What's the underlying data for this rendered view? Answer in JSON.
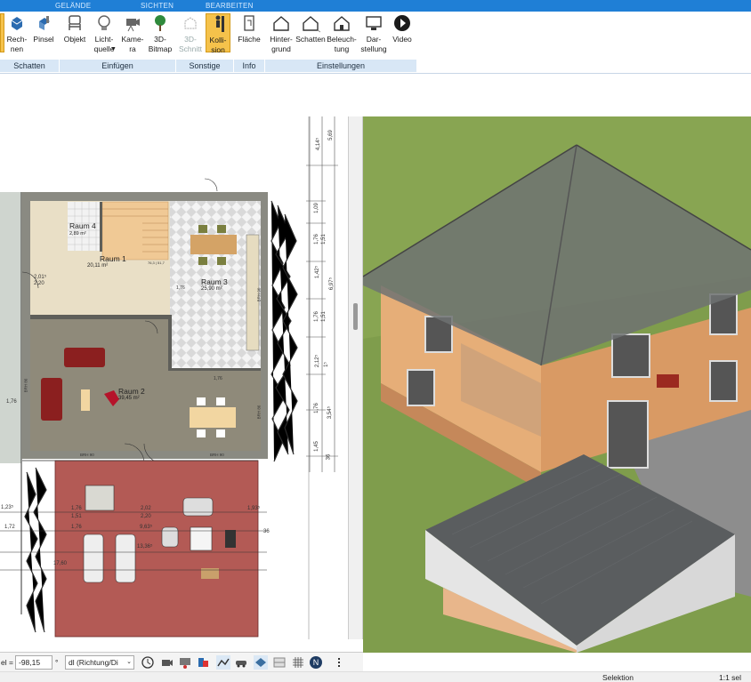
{
  "ribbon": {
    "tabs": [
      "GELÄNDE",
      "SICHTEN",
      "BEARBEITEN"
    ],
    "buttons": {
      "rechnen": "Rech-\nnen",
      "pinsel": "Pinsel",
      "objekt": "Objekt",
      "lichtquelle": "Licht-\nquelle",
      "kamera": "Kame-\nra",
      "bitmap3d": "3D-\nBitmap",
      "schnitt3d": "3D-\nSchnitt",
      "kollision": "Kolli-\nsion",
      "flaeche": "Fläche",
      "hintergrund": "Hinter-\ngrund",
      "schatten": "Schatten",
      "beleuchtung": "Beleuch-\ntung",
      "darstellung": "Dar-\nstellung",
      "video": "Video"
    },
    "groups": {
      "schatten": "Schatten",
      "einfuegen": "Einfügen",
      "sonstige": "Sonstige",
      "info": "Info",
      "einstellungen": "Einstellungen"
    }
  },
  "floorplan": {
    "rooms": [
      {
        "name": "Raum 4",
        "area": "2,89 m²"
      },
      {
        "name": "Raum 1",
        "area": "20,11 m²"
      },
      {
        "name": "Raum 3",
        "area": "25,90 m²"
      },
      {
        "name": "Raum 2",
        "area": "39,45 m²"
      }
    ],
    "dims_right": [
      "5,69",
      "4,14⁵",
      "1,09",
      "1,76",
      "1,51",
      "1,42⁵",
      "6,97⁵",
      "1,76",
      "1,51",
      "2,12⁵",
      "1⁵",
      "1,76",
      "3,54⁵",
      "1,45",
      "36"
    ],
    "dims_left": [
      "1,76",
      "1,23⁵",
      "1,72"
    ],
    "dims_carport": [
      "1,76",
      "1,51",
      "2,02",
      "2,20",
      "1,76",
      "9,63⁵",
      "13,36⁵",
      "17,60",
      "1,93⁵"
    ],
    "small_labels": [
      "BRH 90",
      "BRH 90",
      "BRH 86",
      "BRH 86",
      "BRH 90",
      "2,01⁵",
      "2,20",
      "76,3 | 51,7",
      "1,76",
      "1,76",
      "36"
    ]
  },
  "bottombar": {
    "field_label": "el =",
    "angle_value": "-98,15",
    "angle_unit": "°",
    "mode_select": "dl (Richtung/Di"
  },
  "status": {
    "mode": "Selektion",
    "scale": "1:1 sel"
  },
  "colors": {
    "ribbon_blue": "#1f7fd6",
    "active_button": "#f5c24b",
    "garage_floor": "#b35a55",
    "grass": "#7a9a4a"
  }
}
